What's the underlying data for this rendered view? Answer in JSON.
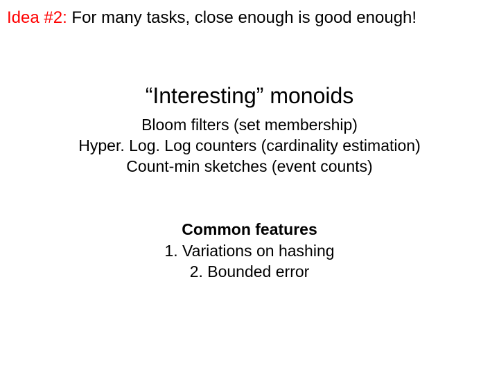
{
  "idea": {
    "prefix": "Idea #2:",
    "text": " For many tasks, close enough is good enough!"
  },
  "title": "“Interesting” monoids",
  "monoids": {
    "line1": "Bloom filters (set membership)",
    "line2": "Hyper. Log. Log counters (cardinality estimation)",
    "line3": "Count-min sketches (event counts)"
  },
  "features": {
    "title": "Common features",
    "item1": "1. Variations on hashing",
    "item2": "2. Bounded error"
  }
}
